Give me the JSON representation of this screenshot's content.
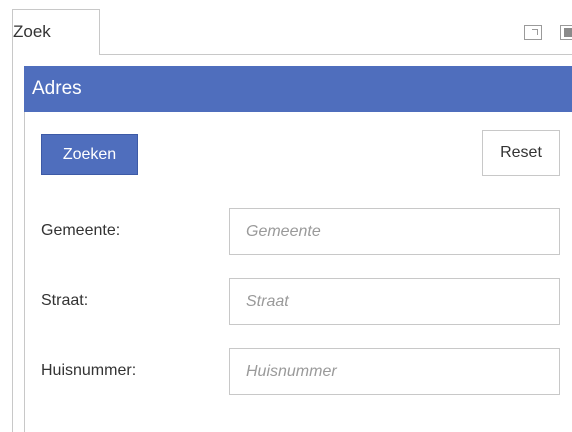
{
  "tab": {
    "label": "Zoek"
  },
  "icons": {
    "maximize": "maximize-icon",
    "pin": "pin-icon"
  },
  "colors": {
    "accent": "#4f6ebd",
    "border": "#c8c8c8",
    "placeholder": "#9a9a9a"
  },
  "section": {
    "title": "Adres"
  },
  "buttons": {
    "search_label": "Zoeken",
    "reset_label": "Reset"
  },
  "form": {
    "fields": [
      {
        "label": "Gemeente:",
        "placeholder": "Gemeente",
        "value": ""
      },
      {
        "label": "Straat:",
        "placeholder": "Straat",
        "value": ""
      },
      {
        "label": "Huisnummer:",
        "placeholder": "Huisnummer",
        "value": ""
      }
    ]
  }
}
